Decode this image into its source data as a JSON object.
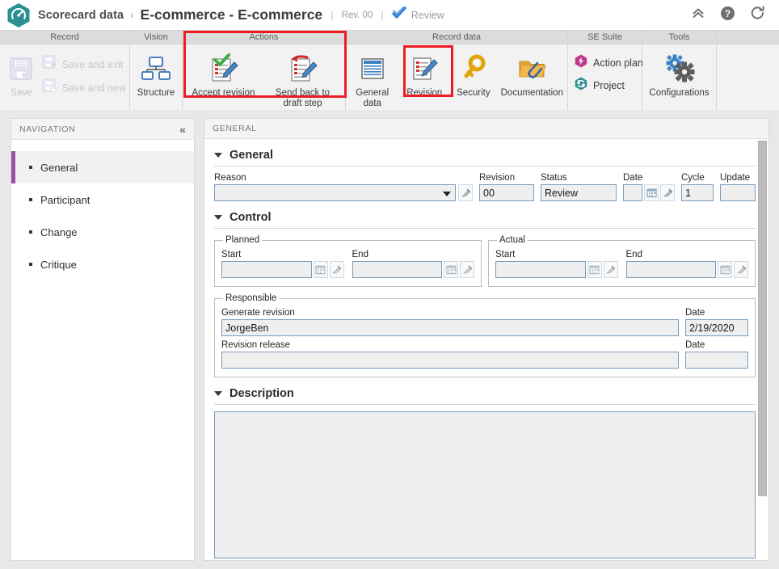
{
  "titlebar": {
    "logo_icon": "gauge-hexagon-logo",
    "breadcrumb_root": "Scorecard data",
    "breadcrumb_separator": "›",
    "title": "E-commerce - E-commerce",
    "divider": "|",
    "revision_label": "Rev. 00",
    "status_icon": "blue-check-icon",
    "status_label": "Review",
    "collapse_icon": "chevron-double-up-icon",
    "help_icon": "help-circle-icon",
    "refresh_icon": "refresh-icon"
  },
  "ribbon": {
    "groups": [
      {
        "name": "Record",
        "save_button": {
          "label": "Save",
          "icon": "floppy-disk-icon",
          "disabled": true
        },
        "small_buttons": [
          {
            "label": "Save and exit",
            "icon": "save-exit-icon",
            "disabled": true
          },
          {
            "label": "Save and new",
            "icon": "save-new-icon",
            "disabled": true
          }
        ]
      },
      {
        "name": "Vision",
        "buttons": [
          {
            "label": "Structure",
            "icon": "org-chart-icon"
          }
        ]
      },
      {
        "name": "Actions",
        "highlighted": true,
        "buttons": [
          {
            "label": "Accept revision",
            "icon": "document-green-check-pencil-icon"
          },
          {
            "label": "Send back to draft step",
            "icon": "document-red-arrow-pencil-icon"
          }
        ]
      },
      {
        "name": "Record data",
        "buttons": [
          {
            "label": "General data",
            "icon": "document-lines-icon"
          },
          {
            "label": "Revision",
            "icon": "document-pencil-icon",
            "highlighted": true
          },
          {
            "label": "Security",
            "icon": "key-icon"
          },
          {
            "label": "Documentation",
            "icon": "folder-paperclip-icon"
          }
        ]
      },
      {
        "name": "SE Suite",
        "items": [
          {
            "label": "Action plan",
            "icon": "action-plan-hexagon-icon",
            "color": "#c0398f"
          },
          {
            "label": "Project",
            "icon": "project-hexagon-icon",
            "color": "#2c8f92"
          }
        ]
      },
      {
        "name": "Tools",
        "buttons": [
          {
            "label": "Configurations",
            "icon": "gears-icon"
          }
        ]
      }
    ]
  },
  "navigation": {
    "header": "NAVIGATION",
    "collapse_icon": "chevron-double-left-icon",
    "items": [
      {
        "label": "General",
        "active": true
      },
      {
        "label": "Participant",
        "active": false
      },
      {
        "label": "Change",
        "active": false
      },
      {
        "label": "Critique",
        "active": false
      }
    ]
  },
  "form": {
    "header": "GENERAL",
    "sections": {
      "general": {
        "title": "General",
        "fields": {
          "reason": {
            "label": "Reason",
            "value": "",
            "icon": "eraser-icon"
          },
          "revision": {
            "label": "Revision",
            "value": "00"
          },
          "status": {
            "label": "Status",
            "value": "Review"
          },
          "date": {
            "label": "Date",
            "value": "",
            "calendar_icon": "calendar-icon",
            "eraser_icon": "eraser-icon"
          },
          "cycle": {
            "label": "Cycle",
            "value": "1"
          },
          "update": {
            "label": "Update",
            "value": ""
          }
        }
      },
      "control": {
        "title": "Control",
        "planned": {
          "legend": "Planned",
          "start": {
            "label": "Start",
            "value": "",
            "calendar_icon": "calendar-icon",
            "eraser_icon": "eraser-icon"
          },
          "end": {
            "label": "End",
            "value": "",
            "calendar_icon": "calendar-icon",
            "eraser_icon": "eraser-icon"
          }
        },
        "actual": {
          "legend": "Actual",
          "start": {
            "label": "Start",
            "value": "",
            "calendar_icon": "calendar-icon",
            "eraser_icon": "eraser-icon"
          },
          "end": {
            "label": "End",
            "value": "",
            "calendar_icon": "calendar-icon",
            "eraser_icon": "eraser-icon"
          }
        },
        "responsible": {
          "legend": "Responsible",
          "generate_revision": {
            "label": "Generate revision",
            "value": "JorgeBen"
          },
          "generate_revision_date": {
            "label": "Date",
            "value": "2/19/2020"
          },
          "revision_release": {
            "label": "Revision release",
            "value": ""
          },
          "revision_release_date": {
            "label": "Date",
            "value": ""
          }
        }
      },
      "description": {
        "title": "Description",
        "value": ""
      }
    }
  },
  "colors": {
    "brand_teal": "#2c8f92",
    "highlight_red": "#ed1c24",
    "nav_active_purple": "#9b4ea8",
    "input_border_blue": "#7a9bbd"
  }
}
